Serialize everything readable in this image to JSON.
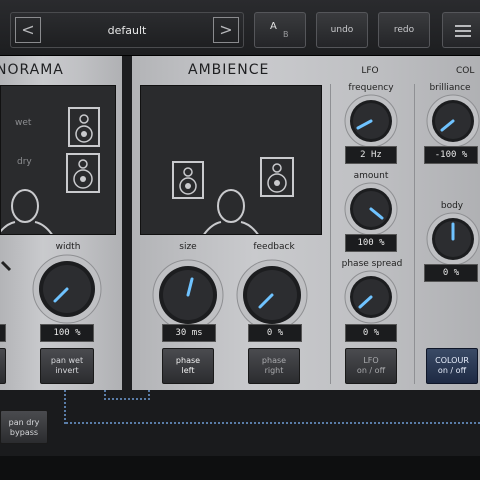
{
  "toolbar": {
    "preset_name": "default",
    "prev_arrow": "<",
    "next_arrow": ">",
    "ab_a": "A",
    "ab_b": "B",
    "undo": "undo",
    "redo": "redo"
  },
  "panorama": {
    "title": "NORAMA",
    "wet_label": "wet",
    "dry_label": "dry",
    "width_label": "width",
    "width_value": "100 %",
    "pan_wet_invert": [
      "pan wet",
      "invert"
    ],
    "pan_dry_bypass": [
      "pan dry",
      "bypass"
    ]
  },
  "ambience": {
    "title": "AMBIENCE",
    "size_label": "size",
    "size_value": "30 ms",
    "feedback_label": "feedback",
    "feedback_value": "0 %",
    "phase_left": [
      "phase",
      "left"
    ],
    "phase_right": [
      "phase",
      "right"
    ]
  },
  "lfo": {
    "title": "LFO",
    "frequency_label": "frequency",
    "frequency_value": "2 Hz",
    "amount_label": "amount",
    "amount_value": "100 %",
    "phase_spread_label": "phase spread",
    "phase_spread_value": "0 %",
    "onoff": [
      "LFO",
      "on / off"
    ]
  },
  "colour": {
    "title": "COL",
    "brilliance_label": "brilliance",
    "brilliance_value": "-100 %",
    "body_label": "body",
    "body_value": "0 %",
    "onoff": [
      "COLOUR",
      "on / off"
    ]
  },
  "colors": {
    "panel": "#c4c5c8",
    "display": "#2a2b2d",
    "indicator": "#6fc3ff",
    "active_button": "#26355a"
  }
}
